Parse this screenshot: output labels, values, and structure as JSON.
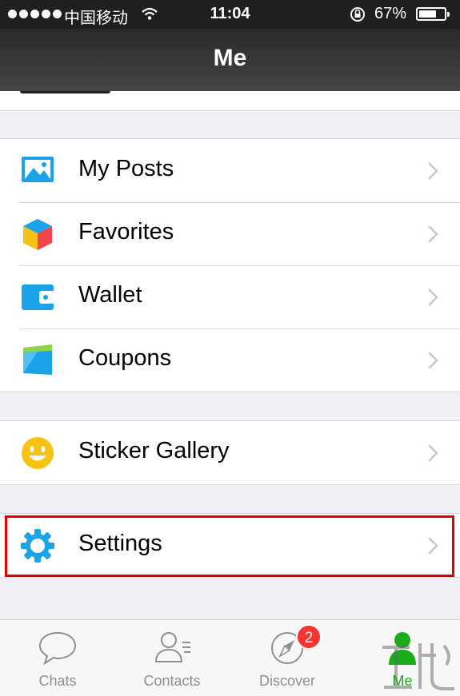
{
  "status_bar": {
    "carrier": "中国移动",
    "time": "11:04",
    "battery": "67%"
  },
  "nav": {
    "title": "Me"
  },
  "menu": {
    "group1": [
      {
        "label": "My Posts",
        "icon": "image-icon"
      },
      {
        "label": "Favorites",
        "icon": "cube-icon"
      },
      {
        "label": "Wallet",
        "icon": "wallet-icon"
      },
      {
        "label": "Coupons",
        "icon": "coupon-icon"
      }
    ],
    "group2": [
      {
        "label": "Sticker Gallery",
        "icon": "smiley-icon"
      }
    ],
    "group3": [
      {
        "label": "Settings",
        "icon": "gear-icon"
      }
    ]
  },
  "tabs": [
    {
      "label": "Chats",
      "icon": "chat-bubble-icon"
    },
    {
      "label": "Contacts",
      "icon": "contacts-icon"
    },
    {
      "label": "Discover",
      "icon": "compass-icon",
      "badge": "2"
    },
    {
      "label": "Me",
      "icon": "person-icon",
      "active": true
    }
  ],
  "colors": {
    "accent_green": "#1aad19",
    "highlight_red": "#e00000",
    "badge_red": "#f43530",
    "icon_blue": "#1aa3e8"
  }
}
